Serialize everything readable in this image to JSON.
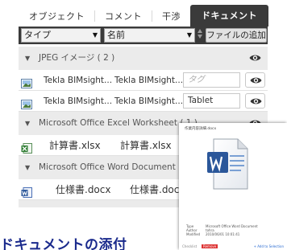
{
  "tabs": [
    {
      "label": "オブジェクト",
      "active": false
    },
    {
      "label": "コメント",
      "active": false
    },
    {
      "label": "干渉",
      "active": false
    },
    {
      "label": "ドキュメント",
      "active": true
    }
  ],
  "toolbar": {
    "type_select": "タイプ",
    "name_select": "名前",
    "add_file_label": "ファイルの追加"
  },
  "groups": [
    {
      "title": "JPEG イメージ ( 2 )",
      "rows": [
        {
          "icon": "jpeg-image-icon",
          "name": "Tekla BIMsight...",
          "name2": "Tekla BIMsight...",
          "tag": "タグ",
          "tag_is_placeholder": true
        },
        {
          "icon": "jpeg-image-icon",
          "name": "Tekla BIMsight...",
          "name2": "Tekla BIMsight...",
          "tag": "Tablet",
          "tag_is_placeholder": false
        }
      ]
    },
    {
      "title": "Microsoft Office Excel Worksheet ( 1 )",
      "rows": [
        {
          "icon": "excel-file-icon",
          "name": "計算書.xlsx",
          "name2": "計算書.xlsx",
          "tag": "タグ",
          "tag_is_placeholder": true
        }
      ]
    },
    {
      "title": "Microsoft Office Word Document ( 1 )",
      "rows": [
        {
          "icon": "word-file-icon",
          "name": "仕様書.docx",
          "name2": "仕様書.docx",
          "tag": "",
          "tag_is_placeholder": false
        }
      ]
    }
  ],
  "preview": {
    "file_title": "作業内容詳細.docx",
    "meta": [
      {
        "key": "Type",
        "value": "Microsoft Office Word Document"
      },
      {
        "key": "Author",
        "value": "tohra"
      },
      {
        "key": "Modified",
        "value": "2010/06/01 10:01:41"
      }
    ],
    "footer_left": "Checklist",
    "remove_label": "Remove",
    "add_label": "+ Add to Selection"
  },
  "caption": "ドキュメントの添付",
  "colors": {
    "active_tab": "#3a3a3a",
    "toolbar": "#3a3a3a",
    "group_bg": "#ebebeb",
    "caption": "#1a2a8c"
  }
}
